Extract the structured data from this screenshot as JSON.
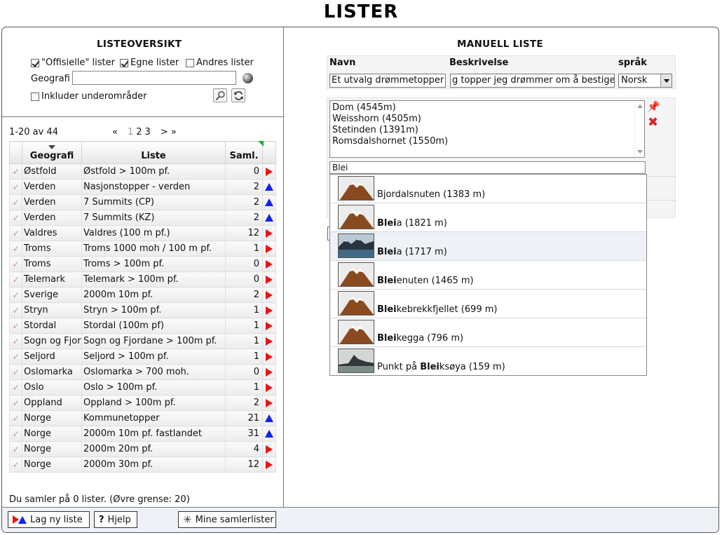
{
  "page": {
    "title": "LISTER"
  },
  "left": {
    "heading": "LISTEOVERSIKT",
    "filters": {
      "official_label": "\"Offisielle\" lister",
      "own_label": "Egne lister",
      "others_label": "Andres lister",
      "official_checked": true,
      "own_checked": true,
      "others_checked": false,
      "geo_label": "Geografi",
      "geo_value": "",
      "include_sub_label": "Inkluder underområder",
      "include_sub_checked": false
    },
    "pager": {
      "info": "1-20 av 44",
      "prev": "«",
      "pages": [
        "1",
        "2",
        "3"
      ],
      "next": "> »"
    },
    "table": {
      "headers": {
        "geo": "Geografi",
        "list": "Liste",
        "count": "Saml."
      },
      "rows": [
        {
          "geo": "Østfold",
          "list": "Østfold > 100m pf.",
          "count": "0",
          "mark": "red"
        },
        {
          "geo": "Verden",
          "list": "Nasjonstopper - verden",
          "count": "2",
          "mark": "blue"
        },
        {
          "geo": "Verden",
          "list": "7 Summits (CP)",
          "count": "2",
          "mark": "blue"
        },
        {
          "geo": "Verden",
          "list": "7 Summits (KZ)",
          "count": "2",
          "mark": "blue"
        },
        {
          "geo": "Valdres",
          "list": "Valdres (100 m pf.)",
          "count": "12",
          "mark": "red"
        },
        {
          "geo": "Troms",
          "list": "Troms 1000 moh / 100 m pf.",
          "count": "1",
          "mark": "red"
        },
        {
          "geo": "Troms",
          "list": "Troms > 100m pf.",
          "count": "0",
          "mark": "red"
        },
        {
          "geo": "Telemark",
          "list": "Telemark > 100m pf.",
          "count": "0",
          "mark": "red"
        },
        {
          "geo": "Sverige",
          "list": "2000m 10m pf.",
          "count": "2",
          "mark": "red"
        },
        {
          "geo": "Stryn",
          "list": "Stryn > 100m pf.",
          "count": "1",
          "mark": "red"
        },
        {
          "geo": "Stordal",
          "list": "Stordal (100m pf)",
          "count": "1",
          "mark": "red"
        },
        {
          "geo": "Sogn og Fjordane",
          "list": "Sogn og Fjordane > 100m pf.",
          "count": "1",
          "mark": "red"
        },
        {
          "geo": "Seljord",
          "list": "Seljord > 100m pf.",
          "count": "1",
          "mark": "red"
        },
        {
          "geo": "Oslomarka",
          "list": "Oslomarka > 700 moh.",
          "count": "0",
          "mark": "red"
        },
        {
          "geo": "Oslo",
          "list": "Oslo > 100m pf.",
          "count": "1",
          "mark": "red"
        },
        {
          "geo": "Oppland",
          "list": "Oppland > 100m pf.",
          "count": "2",
          "mark": "red"
        },
        {
          "geo": "Norge",
          "list": "Kommunetopper",
          "count": "21",
          "mark": "blue"
        },
        {
          "geo": "Norge",
          "list": "2000m 10m pf. fastlandet",
          "count": "31",
          "mark": "blue"
        },
        {
          "geo": "Norge",
          "list": "2000m 20m pf.",
          "count": "4",
          "mark": "red"
        },
        {
          "geo": "Norge",
          "list": "2000m 30m pf.",
          "count": "12",
          "mark": "red"
        }
      ]
    },
    "status": "Du samler på 0 lister. (Øvre grense: 20)"
  },
  "bottom": {
    "new_list": "Lag ny liste",
    "help": "Hjelp",
    "my_lists": "Mine samlerlister"
  },
  "right": {
    "heading": "MANUELL LISTE",
    "form": {
      "name_label": "Navn",
      "desc_label": "Beskrivelse",
      "lang_label": "språk",
      "name_value": "Et utvalg drømmetopper",
      "desc_value": "g topper jeg drømmer om å bestige",
      "lang_value": "Norsk"
    },
    "list_entries": [
      "Dom (4545m)",
      "Weisshorn (4505m)",
      "Stetinden (1391m)",
      "Romsdalshornet (1550m)"
    ],
    "search_value": "Blei",
    "suggestions": [
      {
        "pre": "",
        "match": "",
        "post": "Bjordalsnuten (1383 m)",
        "thumb": "mountain-icon"
      },
      {
        "pre": "",
        "match": "Blei",
        "post": "a (1821 m)",
        "thumb": "mountain-icon"
      },
      {
        "pre": "",
        "match": "Blei",
        "post": "a (1717 m)",
        "thumb": "photo-fjord"
      },
      {
        "pre": "",
        "match": "Blei",
        "post": "enuten (1465 m)",
        "thumb": "mountain-icon"
      },
      {
        "pre": "",
        "match": "Blei",
        "post": "kebrekkfjellet (699 m)",
        "thumb": "mountain-icon"
      },
      {
        "pre": "",
        "match": "Blei",
        "post": "kegga (796 m)",
        "thumb": "mountain-icon"
      },
      {
        "pre": "Punkt på ",
        "match": "Blei",
        "post": "ksøya (159 m)",
        "thumb": "photo-island"
      }
    ]
  },
  "colors": {
    "red_marker": "#ee1111",
    "blue_marker": "#1122ee",
    "accent_green": "#22aa33"
  }
}
